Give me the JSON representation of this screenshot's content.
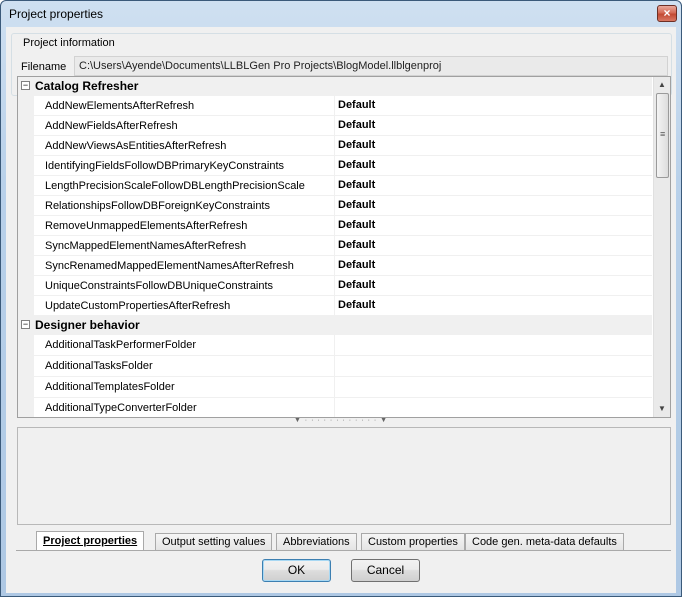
{
  "window": {
    "title": "Project properties",
    "close_glyph": "×"
  },
  "project_info": {
    "legend": "Project information",
    "filename_label": "Filename",
    "filename_value": "C:\\Users\\Ayende\\Documents\\LLBLGen Pro Projects\\BlogModel.llblgenproj"
  },
  "grid": {
    "categories": [
      {
        "name": "Catalog Refresher",
        "toggle": "−",
        "properties": [
          {
            "name": "AddNewElementsAfterRefresh",
            "value": "Default"
          },
          {
            "name": "AddNewFieldsAfterRefresh",
            "value": "Default"
          },
          {
            "name": "AddNewViewsAsEntitiesAfterRefresh",
            "value": "Default"
          },
          {
            "name": "IdentifyingFieldsFollowDBPrimaryKeyConstraints",
            "value": "Default"
          },
          {
            "name": "LengthPrecisionScaleFollowDBLengthPrecisionScale",
            "value": "Default"
          },
          {
            "name": "RelationshipsFollowDBForeignKeyConstraints",
            "value": "Default"
          },
          {
            "name": "RemoveUnmappedElementsAfterRefresh",
            "value": "Default"
          },
          {
            "name": "SyncMappedElementNamesAfterRefresh",
            "value": "Default"
          },
          {
            "name": "SyncRenamedMappedElementNamesAfterRefresh",
            "value": "Default"
          },
          {
            "name": "UniqueConstraintsFollowDBUniqueConstraints",
            "value": "Default"
          },
          {
            "name": "UpdateCustomPropertiesAfterRefresh",
            "value": "Default"
          }
        ]
      },
      {
        "name": "Designer behavior",
        "toggle": "−",
        "properties": [
          {
            "name": "AdditionalTaskPerformerFolder",
            "value": ""
          },
          {
            "name": "AdditionalTasksFolder",
            "value": ""
          },
          {
            "name": "AdditionalTemplatesFolder",
            "value": ""
          },
          {
            "name": "AdditionalTypeConverterFolder",
            "value": ""
          }
        ]
      }
    ],
    "scroll": {
      "up": "▲",
      "down": "▼",
      "grip": "≡"
    }
  },
  "splitter_glyph": "▼ · · · · · · · · · · · · ▼",
  "tabs": [
    {
      "label": "Project properties",
      "active": true
    },
    {
      "label": "Output setting values",
      "active": false
    },
    {
      "label": "Abbreviations",
      "active": false
    },
    {
      "label": "Custom properties",
      "active": false
    },
    {
      "label": "Code gen. meta-data defaults",
      "active": false
    }
  ],
  "buttons": {
    "ok": "OK",
    "cancel": "Cancel"
  }
}
